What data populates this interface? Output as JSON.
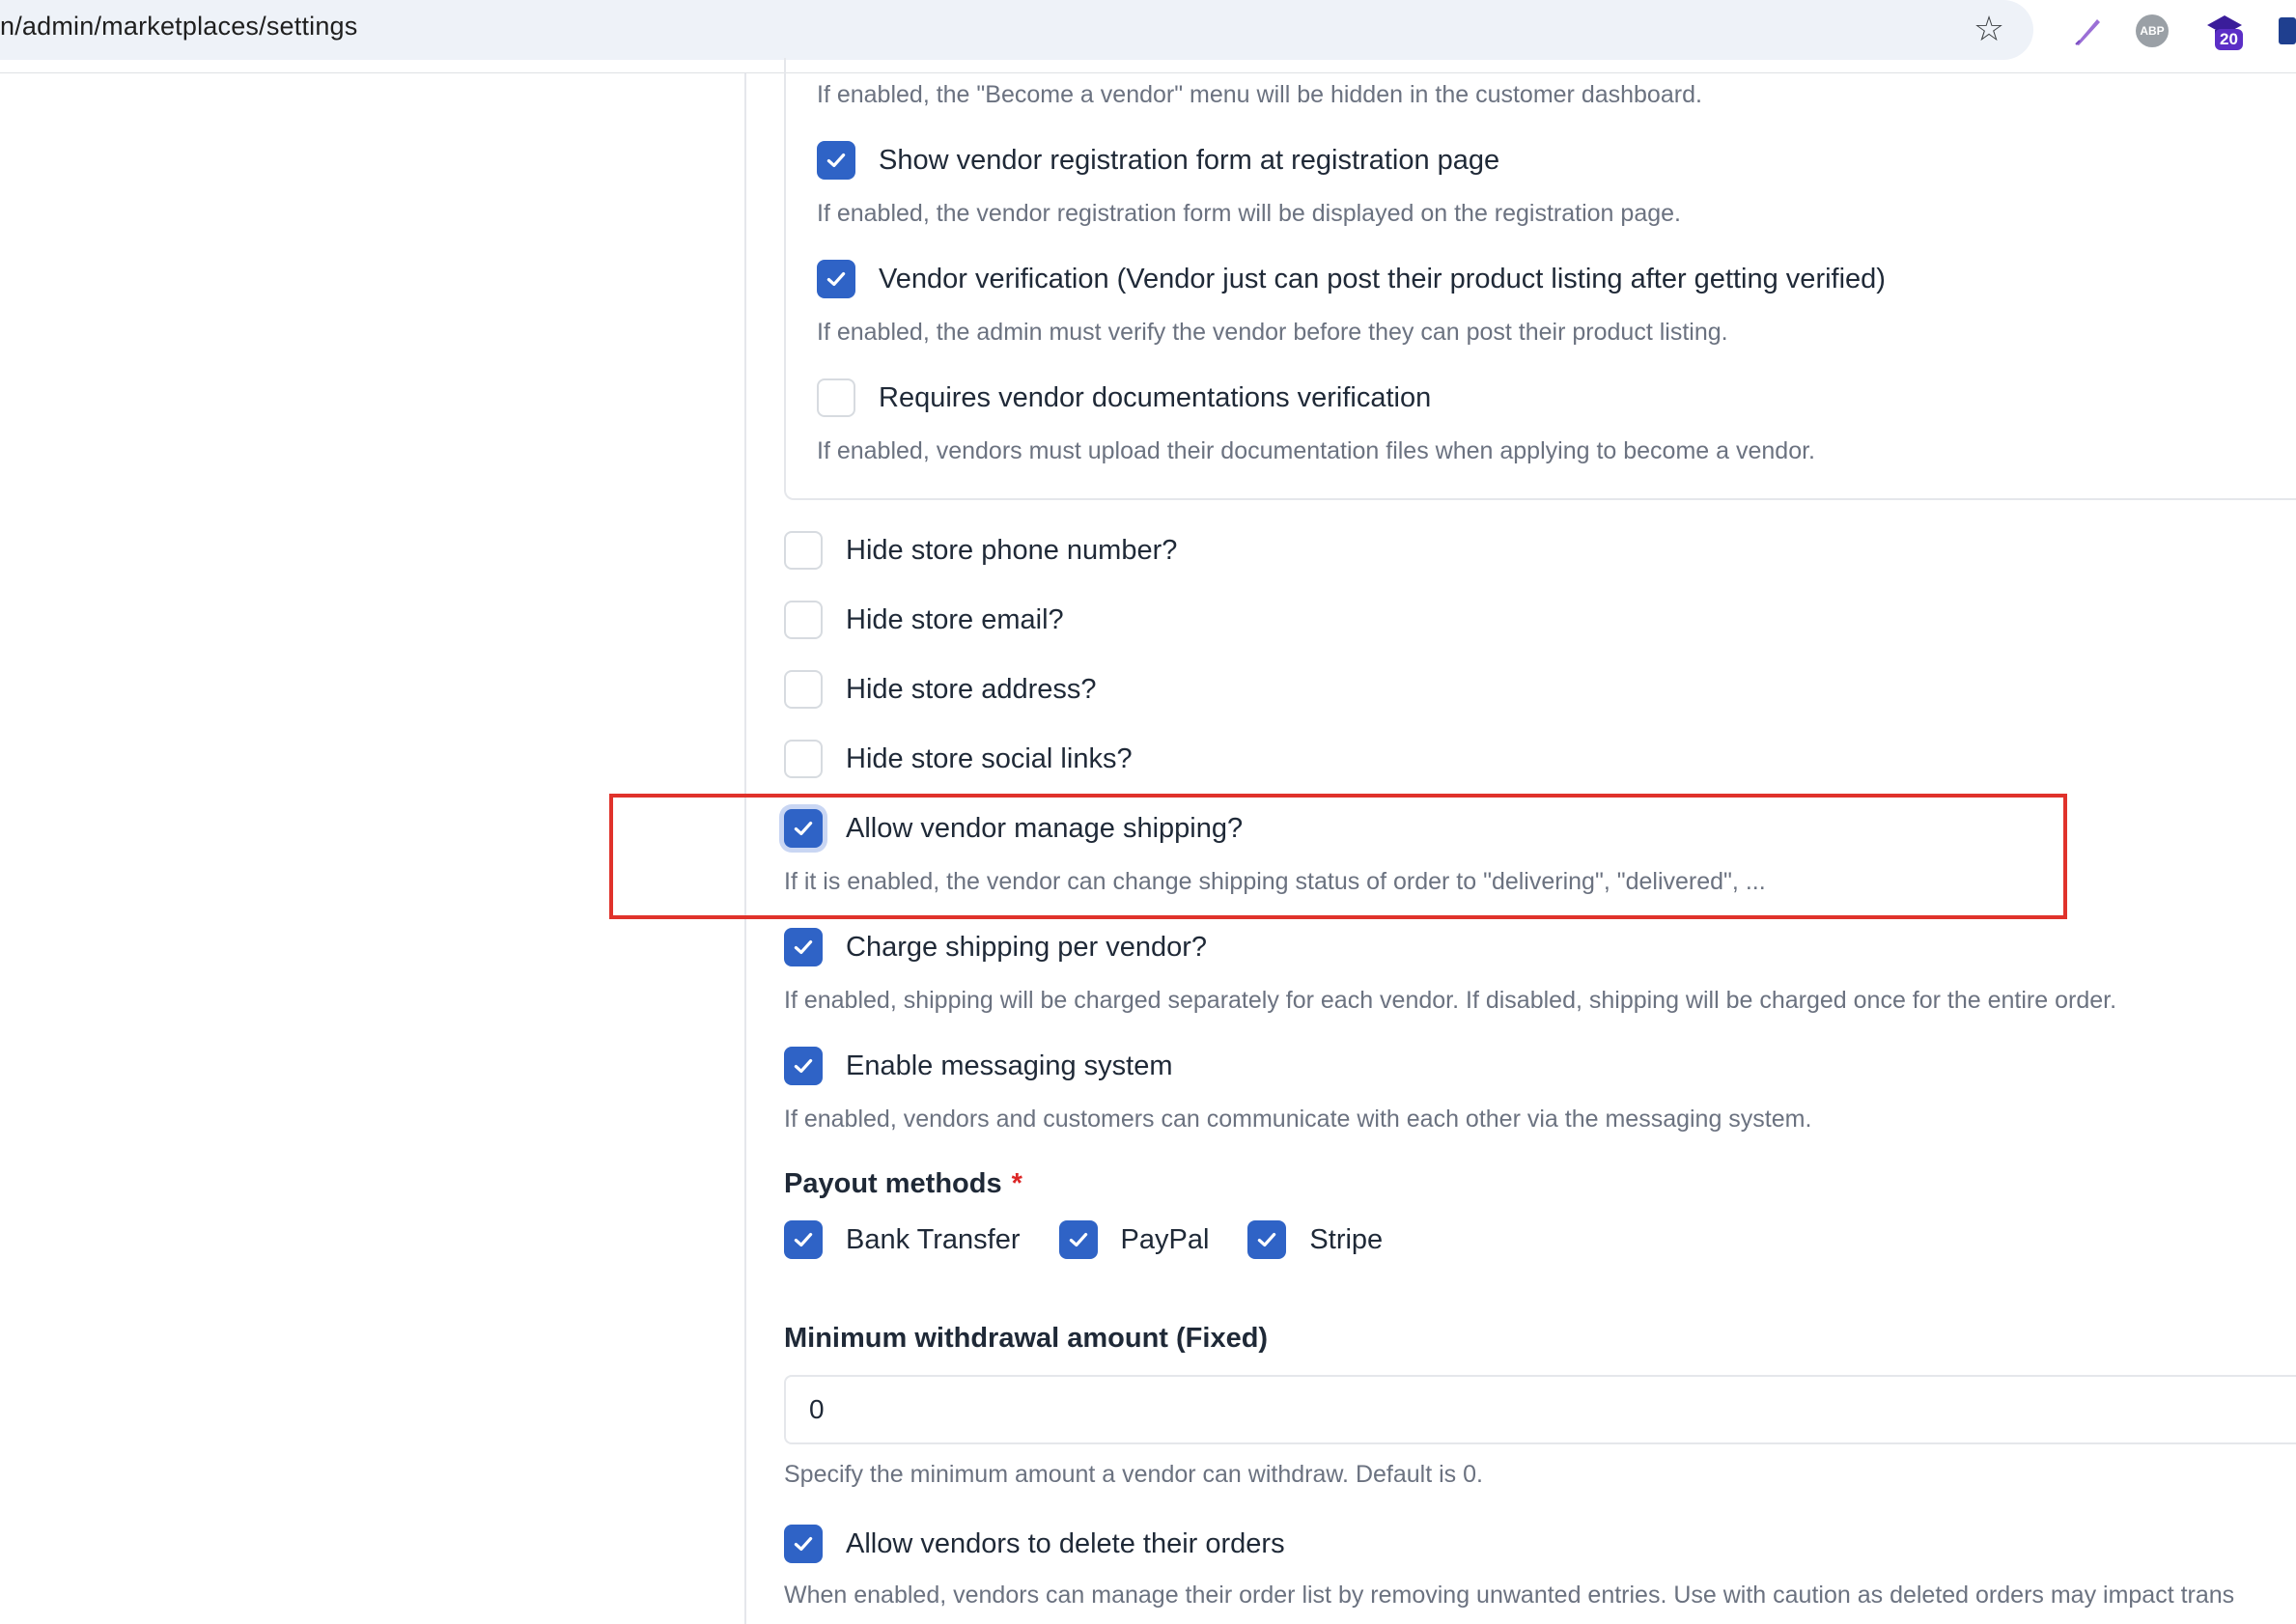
{
  "browser": {
    "url": "n/admin/marketplaces/settings",
    "extensions": [
      "quill-icon",
      "abp-icon",
      "graduation-cap-icon",
      "extension-icon"
    ],
    "abp_label": "ABP",
    "grad_badge": "20"
  },
  "nested": {
    "top_help": "If enabled, the \"Become a vendor\" menu will be hidden in the customer dashboard.",
    "items": [
      {
        "label": "Show vendor registration form at registration page",
        "checked": true,
        "help": "If enabled, the vendor registration form will be displayed on the registration page."
      },
      {
        "label": "Vendor verification (Vendor just can post their product listing after getting verified)",
        "checked": true,
        "help": "If enabled, the admin must verify the vendor before they can post their product listing."
      },
      {
        "label": "Requires vendor documentations verification",
        "checked": false,
        "help": "If enabled, vendors must upload their documentation files when applying to become a vendor."
      }
    ]
  },
  "options": [
    {
      "label": "Hide store phone number?",
      "checked": false
    },
    {
      "label": "Hide store email?",
      "checked": false
    },
    {
      "label": "Hide store address?",
      "checked": false
    },
    {
      "label": "Hide store social links?",
      "checked": false
    },
    {
      "label": "Allow vendor manage shipping?",
      "checked": true,
      "help": "If it is enabled, the vendor can change shipping status of order to \"delivering\", \"delivered\", ..."
    },
    {
      "label": "Charge shipping per vendor?",
      "checked": true,
      "help": "If enabled, shipping will be charged separately for each vendor. If disabled, shipping will be charged once for the entire order."
    },
    {
      "label": "Enable messaging system",
      "checked": true,
      "help": "If enabled, vendors and customers can communicate with each other via the messaging system."
    }
  ],
  "payout": {
    "label": "Payout methods",
    "required_mark": "*",
    "methods": [
      {
        "label": "Bank Transfer",
        "checked": true
      },
      {
        "label": "PayPal",
        "checked": true
      },
      {
        "label": "Stripe",
        "checked": true
      }
    ]
  },
  "withdrawal": {
    "label": "Minimum withdrawal amount (Fixed)",
    "value": "0",
    "help": "Specify the minimum amount a vendor can withdraw. Default is 0."
  },
  "delete_orders": {
    "label": "Allow vendors to delete their orders",
    "checked": true,
    "help": "When enabled, vendors can manage their order list by removing unwanted entries. Use with caution as deleted orders may impact trans"
  },
  "colors": {
    "checkbox_checked": "#2f63c6",
    "highlight": "#e0322b"
  }
}
